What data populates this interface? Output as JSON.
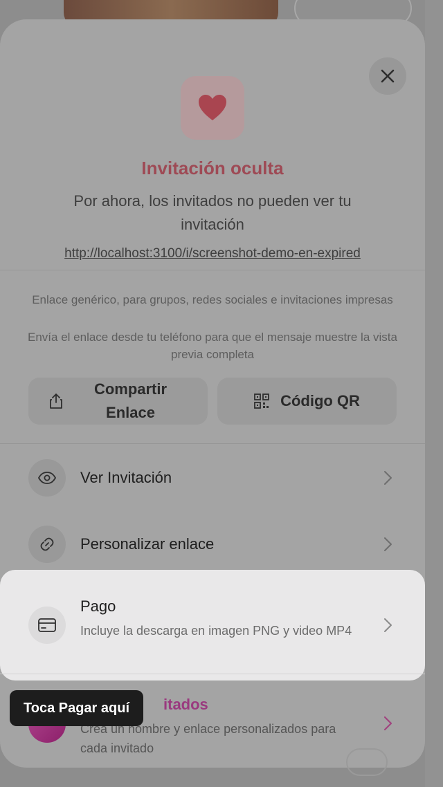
{
  "modal": {
    "close_label": "close",
    "title": "Invitación oculta",
    "subtitle": "Por ahora, los invitados no pueden ver tu invitación",
    "url": "http://localhost:3100/i/screenshot-demo-en-expired",
    "note_line1": "Enlace genérico, para grupos, redes sociales e invitaciones impresas",
    "note_line2": "Envía el enlace desde tu teléfono para que el mensaje muestre la vista previa completa",
    "share_button": "Compartir Enlace",
    "qr_button": "Código QR"
  },
  "menu": {
    "items": [
      {
        "label": "Ver Invitación",
        "icon": "eye-icon"
      },
      {
        "label": "Personalizar enlace",
        "icon": "link-icon"
      }
    ],
    "payment": {
      "label": "Pago",
      "description": "Incluye la descarga en imagen PNG y video MP4",
      "icon": "credit-card-icon"
    },
    "invitados": {
      "label_visible": "itados",
      "description": "Crea un nombre y enlace personalizados para cada invitado",
      "icon": "gift-icon"
    }
  },
  "tooltip": {
    "text": "Toca Pagar aquí"
  },
  "colors": {
    "accent": "#d94451",
    "highlight_bg": "#e9e8e9",
    "tooltip_bg": "#1d1d1d",
    "invitados_accent": "#c2228c"
  }
}
